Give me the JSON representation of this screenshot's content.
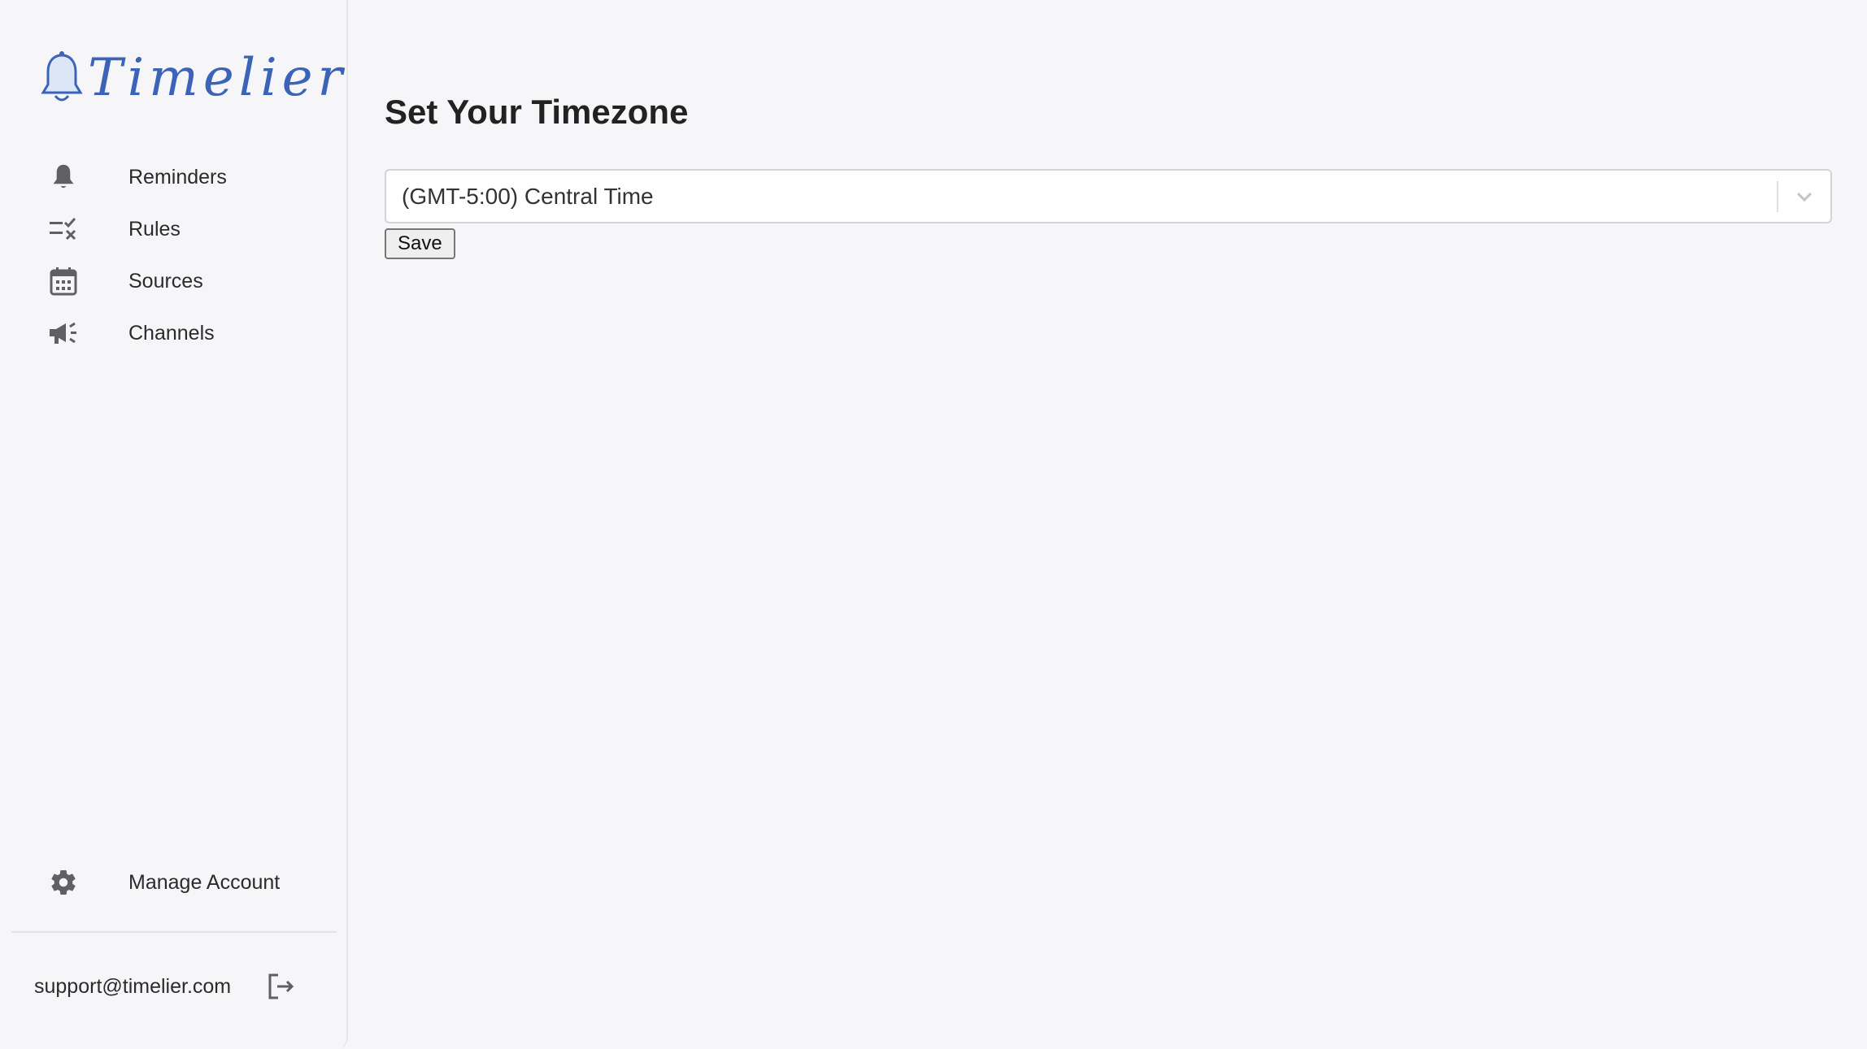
{
  "brand": {
    "name": "Timelier",
    "color": "#3b63b8"
  },
  "sidebar": {
    "items": [
      {
        "label": "Reminders",
        "icon": "bell-icon"
      },
      {
        "label": "Rules",
        "icon": "checklist-icon"
      },
      {
        "label": "Sources",
        "icon": "calendar-icon"
      },
      {
        "label": "Channels",
        "icon": "megaphone-icon"
      }
    ],
    "manage": {
      "label": "Manage Account",
      "icon": "gear-icon"
    },
    "user_email": "support@timelier.com",
    "logout_icon": "logout-icon"
  },
  "main": {
    "title": "Set Your Timezone",
    "timezone_select": {
      "value": "(GMT-5:00) Central Time"
    },
    "save_label": "Save"
  }
}
